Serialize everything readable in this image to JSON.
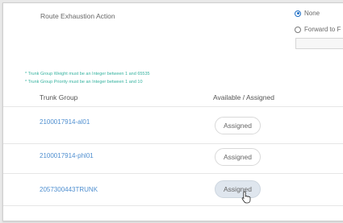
{
  "route_exhaustion": {
    "label": "Route Exhaustion Action",
    "options": [
      {
        "label": "None",
        "selected": true
      },
      {
        "label": "Forward to F",
        "selected": false
      }
    ],
    "forward_value": ""
  },
  "notes": [
    "* Trunk Group Weight must be an Integer between 1 and 65535",
    "* Trunk Group Priority must be an Integer between 1 and 10"
  ],
  "table": {
    "headers": [
      "Trunk Group",
      "Available / Assigned"
    ],
    "rows": [
      {
        "trunk_group": "2100017914-al01",
        "status": "Assigned"
      },
      {
        "trunk_group": "2100017914-phl01",
        "status": "Assigned"
      },
      {
        "trunk_group": "2057300443TRUNK",
        "status": "Assigned"
      }
    ]
  },
  "colors": {
    "accent": "#1f6fc5",
    "link": "#4f8fd0",
    "note": "#37b3a0"
  }
}
